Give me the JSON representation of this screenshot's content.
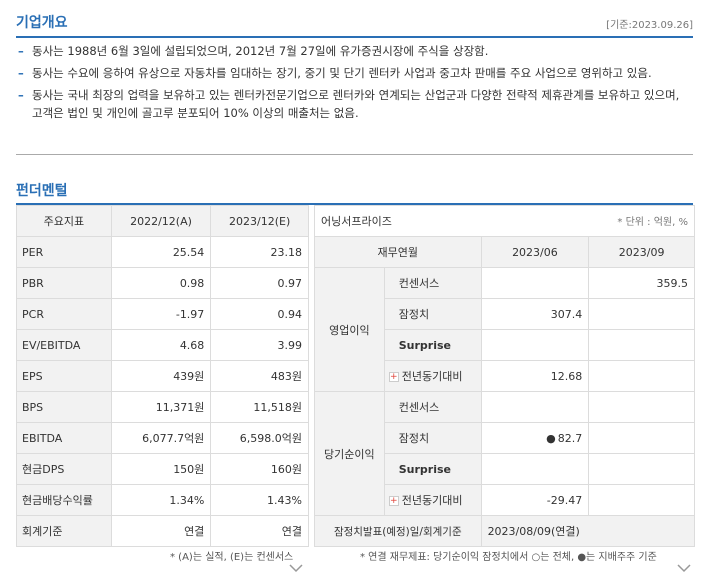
{
  "overview": {
    "title": "기업개요",
    "base_date": "[기준:2023.09.26]",
    "bullets": [
      "동사는 1988년 6월 3일에 설립되었으며, 2012년 7월 27일에 유가증권시장에 주식을 상장함.",
      "동사는 수요에 응하여 유상으로 자동차를 임대하는 장기, 중기 및 단기 렌터카 사업과 중고차 판매를 주요 사업으로 영위하고 있음.",
      "동사는 국내 최장의 업력을 보유하고 있는 렌터카전문기업으로 렌터카와 연계되는 산업군과 다양한 전략적 제휴관계를 보유하고 있으며, 고객은 법인 및 개인에 골고루 분포되어 10% 이상의 매출처는 없음."
    ]
  },
  "fundamental": {
    "title": "펀더멘털",
    "headers": [
      "주요지표",
      "2022/12(A)",
      "2023/12(E)"
    ],
    "rows": [
      {
        "label": "PER",
        "a": "25.54",
        "e": "23.18"
      },
      {
        "label": "PBR",
        "a": "0.98",
        "e": "0.97"
      },
      {
        "label": "PCR",
        "a": "-1.97",
        "e": "0.94"
      },
      {
        "label": "EV/EBITDA",
        "a": "4.68",
        "e": "3.99"
      },
      {
        "label": "EPS",
        "a": "439원",
        "e": "483원"
      },
      {
        "label": "BPS",
        "a": "11,371원",
        "e": "11,518원"
      },
      {
        "label": "EBITDA",
        "a": "6,077.7억원",
        "e": "6,598.0억원"
      },
      {
        "label": "현금DPS",
        "a": "150원",
        "e": "160원"
      },
      {
        "label": "현금배당수익률",
        "a": "1.34%",
        "e": "1.43%"
      },
      {
        "label": "회계기준",
        "a": "연결",
        "e": "연결"
      }
    ],
    "note": "* (A)는 실적, (E)는 컨센서스"
  },
  "earnings": {
    "title": "어닝서프라이즈",
    "unit": "* 단위 : 억원, %",
    "headers": [
      "재무연월",
      "2023/06",
      "2023/09"
    ],
    "op_label": "영업이익",
    "ni_label": "당기순이익",
    "op_rows": [
      {
        "label": "컨센서스",
        "v1": "",
        "v2": "359.5"
      },
      {
        "label": "잠정치",
        "v1": "307.4",
        "v2": ""
      },
      {
        "label": "Surprise",
        "v1": "",
        "v2": ""
      },
      {
        "label": "전년동기대비",
        "v1": "12.68",
        "v2": ""
      }
    ],
    "ni_rows": [
      {
        "label": "컨센서스",
        "v1": "",
        "v2": ""
      },
      {
        "label": "잠정치",
        "v1": "82.7",
        "v2": ""
      },
      {
        "label": "Surprise",
        "v1": "",
        "v2": ""
      },
      {
        "label": "전년동기대비",
        "v1": "-29.47",
        "v2": ""
      }
    ],
    "ni_dot": "●",
    "plus_glyph": "+",
    "footer_label": "잠정치발표(예정)일/회계기준",
    "footer_value": "2023/08/09(연결)",
    "note": "* 연결 재무제표: 당기순이익 잠정치에서 ○는 전체, ●는 지배주주 기준"
  }
}
